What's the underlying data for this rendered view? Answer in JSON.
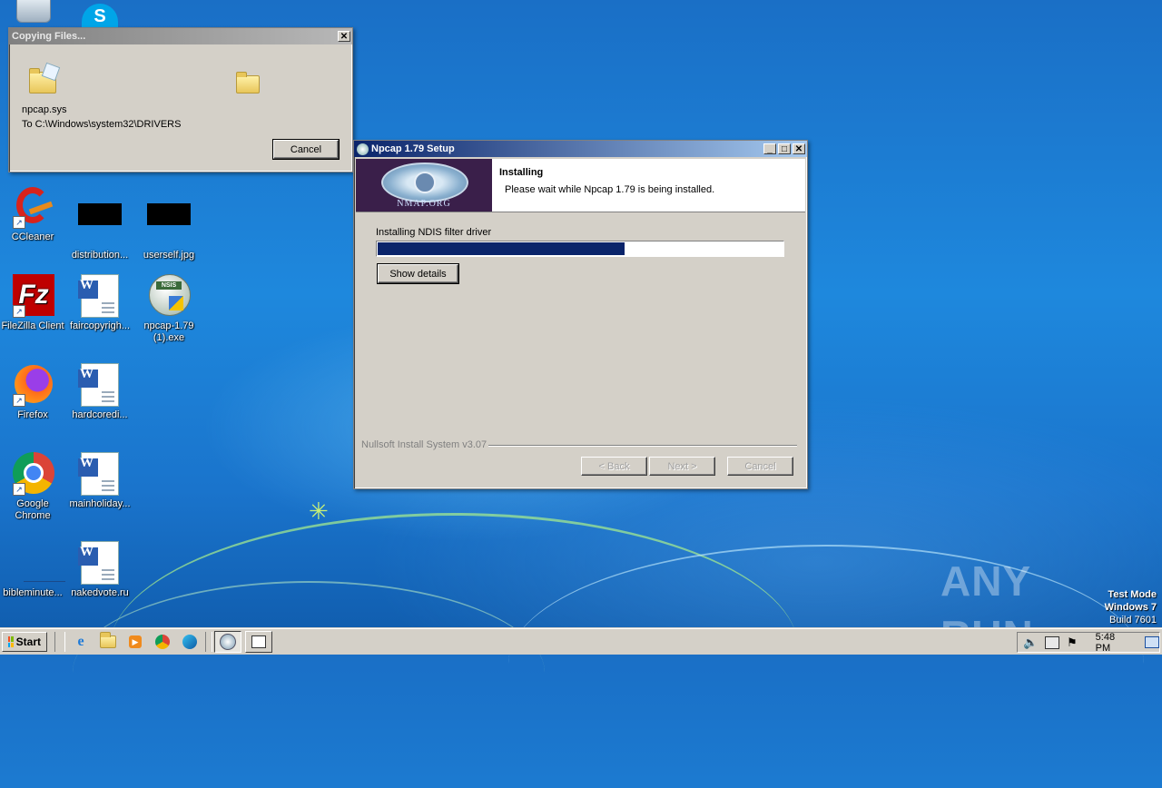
{
  "desktop": {
    "icons": [
      {
        "label": "CCleaner"
      },
      {
        "label": "distribution..."
      },
      {
        "label": "userself.jpg"
      },
      {
        "label": "FileZilla Client"
      },
      {
        "label": "faircopyrigh..."
      },
      {
        "label": "npcap-1.79 (1).exe"
      },
      {
        "label": "Firefox"
      },
      {
        "label": "hardcoredi..."
      },
      {
        "label": "Google Chrome"
      },
      {
        "label": "mainholiday..."
      },
      {
        "label": "bibleminute..."
      },
      {
        "label": "nakedvote.ru"
      }
    ],
    "watermark": {
      "brand": "ANY RUN",
      "mode": "Test Mode",
      "os": "Windows 7",
      "build": "Build 7601"
    }
  },
  "copy_dialog": {
    "title": "Copying Files...",
    "file": "npcap.sys",
    "destination": "To C:\\Windows\\system32\\DRIVERS",
    "cancel_label": "Cancel"
  },
  "setup": {
    "title": "Npcap 1.79 Setup",
    "header_title": "Installing",
    "header_subtitle": "Please wait while Npcap 1.79 is being installed.",
    "logo_text": "NMAP.ORG",
    "status": "Installing NDIS filter driver",
    "progress": 0.61,
    "show_details_label": "Show details",
    "branding": "Nullsoft Install System v3.07",
    "back_label": "< Back",
    "next_label": "Next >",
    "cancel_label": "Cancel"
  },
  "taskbar": {
    "start_label": "Start",
    "clock": "5:48 PM",
    "quicklaunch": [
      "ie-icon",
      "explorer-icon",
      "media-player-icon",
      "chrome-icon",
      "edge-icon"
    ],
    "tasks": [
      "npcap-setup-task-icon",
      "copy-task-icon"
    ]
  },
  "colors": {
    "titlebar_active": "#0a246a",
    "progress_fill": "#0a246a",
    "desktop": "#1e88dd"
  }
}
